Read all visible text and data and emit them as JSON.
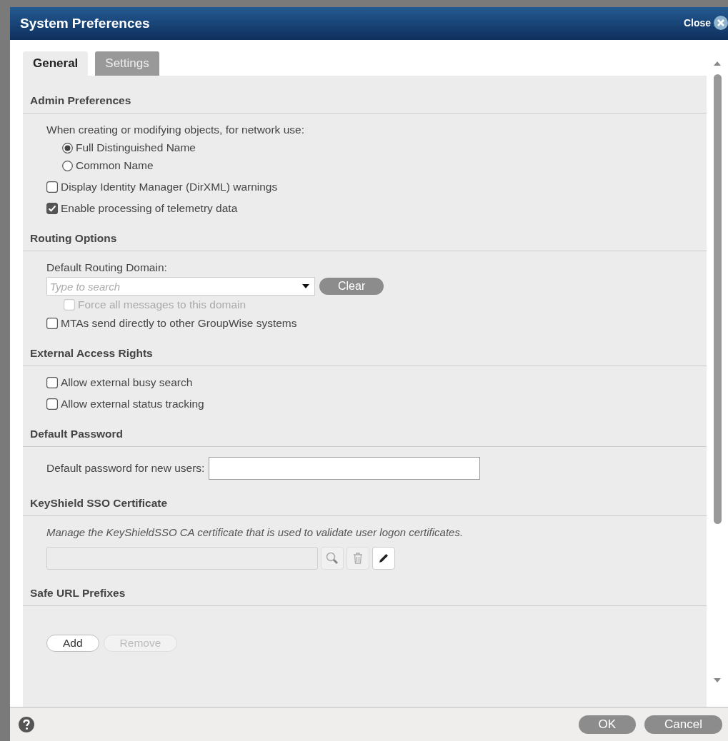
{
  "window": {
    "title": "System Preferences",
    "close_label": "Close"
  },
  "tabs": [
    {
      "label": "General",
      "selected": true
    },
    {
      "label": "Settings",
      "selected": false
    }
  ],
  "sections": [
    {
      "title": "Admin Preferences",
      "items": [
        {
          "kind": "radio-group",
          "label": "When creating or modifying objects, for network use:",
          "options": [
            {
              "label": "Full Distinguished Name",
              "selected": true
            },
            {
              "label": "Common Name",
              "selected": false
            }
          ]
        },
        {
          "kind": "checkbox",
          "label": "Display Identity Manager (DirXML) warnings",
          "checked": false,
          "disabled": false
        },
        {
          "kind": "checkbox",
          "label": "Enable processing of telemetry data",
          "checked": true,
          "disabled": false
        }
      ]
    },
    {
      "title": "Routing Options",
      "items": [
        {
          "kind": "combo",
          "label": "Default Routing Domain:",
          "placeholder": "Type to search",
          "button": "Clear",
          "children": [
            {
              "kind": "checkbox",
              "label": "Force all messages to this domain",
              "checked": false,
              "disabled": true
            }
          ]
        },
        {
          "kind": "checkbox",
          "label": "MTAs send directly to other GroupWise systems",
          "checked": false,
          "disabled": false
        }
      ]
    },
    {
      "title": "External Access Rights",
      "items": [
        {
          "kind": "checkbox",
          "label": "Allow external busy search",
          "checked": false,
          "disabled": false
        },
        {
          "kind": "checkbox",
          "label": "Allow external status tracking",
          "checked": false,
          "disabled": false
        }
      ]
    },
    {
      "title": "Default Password",
      "items": [
        {
          "kind": "password",
          "label": "Default password for new users:"
        }
      ]
    },
    {
      "title": "KeyShield SSO Certificate",
      "items": [
        {
          "kind": "cert",
          "description": "Manage the KeyShieldSSO CA certificate that is used to validate user logon certificates."
        }
      ]
    },
    {
      "title": "Safe URL Prefixes",
      "items": [
        {
          "kind": "url-list",
          "buttons": [
            {
              "label": "Add",
              "disabled": false
            },
            {
              "label": "Remove",
              "disabled": true
            }
          ]
        }
      ]
    }
  ],
  "footer": {
    "buttons": [
      "OK",
      "Cancel"
    ]
  }
}
